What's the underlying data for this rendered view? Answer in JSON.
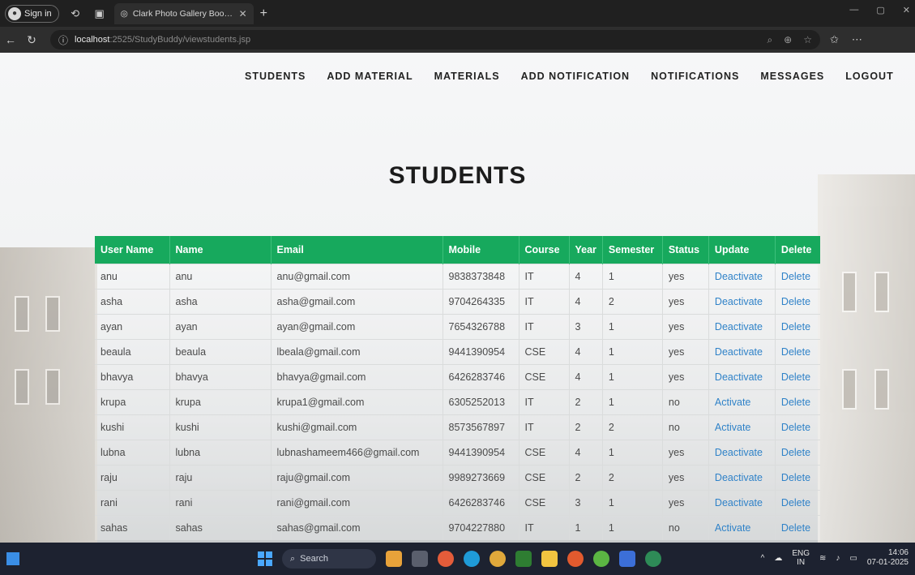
{
  "browser": {
    "profile_label": "Sign in",
    "tab_title": "Clark Photo Gallery Bootstrap Re",
    "url_host": "localhost",
    "url_path": ":2525/StudyBuddy/viewstudents.jsp"
  },
  "nav": {
    "items": [
      "STUDENTS",
      "ADD MATERIAL",
      "MATERIALS",
      "ADD NOTIFICATION",
      "NOTIFICATIONS",
      "MESSAGES",
      "LOGOUT"
    ]
  },
  "page_title": "STUDENTS",
  "table": {
    "headers": [
      "User Name",
      "Name",
      "Email",
      "Mobile",
      "Course",
      "Year",
      "Semester",
      "Status",
      "Update",
      "Delete"
    ],
    "rows": [
      [
        "anu",
        "anu",
        "anu@gmail.com",
        "9838373848",
        "IT",
        "4",
        "1",
        "yes",
        "Deactivate",
        "Delete"
      ],
      [
        "asha",
        "asha",
        "asha@gmail.com",
        "9704264335",
        "IT",
        "4",
        "2",
        "yes",
        "Deactivate",
        "Delete"
      ],
      [
        "ayan",
        "ayan",
        "ayan@gmail.com",
        "7654326788",
        "IT",
        "3",
        "1",
        "yes",
        "Deactivate",
        "Delete"
      ],
      [
        "beaula",
        "beaula",
        "lbeala@gmail.com",
        "9441390954",
        "CSE",
        "4",
        "1",
        "yes",
        "Deactivate",
        "Delete"
      ],
      [
        "bhavya",
        "bhavya",
        "bhavya@gmail.com",
        "6426283746",
        "CSE",
        "4",
        "1",
        "yes",
        "Deactivate",
        "Delete"
      ],
      [
        "krupa",
        "krupa",
        "krupa1@gmail.com",
        "6305252013",
        "IT",
        "2",
        "1",
        "no",
        "Activate",
        "Delete"
      ],
      [
        "kushi",
        "kushi",
        "kushi@gmail.com",
        "8573567897",
        "IT",
        "2",
        "2",
        "no",
        "Activate",
        "Delete"
      ],
      [
        "lubna",
        "lubna",
        "lubnashameem466@gmail.com",
        "9441390954",
        "CSE",
        "4",
        "1",
        "yes",
        "Deactivate",
        "Delete"
      ],
      [
        "raju",
        "raju",
        "raju@gmail.com",
        "9989273669",
        "CSE",
        "2",
        "2",
        "yes",
        "Deactivate",
        "Delete"
      ],
      [
        "rani",
        "rani",
        "rani@gmail.com",
        "6426283746",
        "CSE",
        "3",
        "1",
        "yes",
        "Deactivate",
        "Delete"
      ],
      [
        "sahas",
        "sahas",
        "sahas@gmail.com",
        "9704227880",
        "IT",
        "1",
        "1",
        "no",
        "Activate",
        "Delete"
      ]
    ]
  },
  "taskbar": {
    "search_label": "Search",
    "lang_top": "ENG",
    "lang_bottom": "IN",
    "time": "14:06",
    "date": "07-01-2025"
  },
  "colors": {
    "header_green": "#17a95d",
    "link_blue": "#2f82c8"
  }
}
